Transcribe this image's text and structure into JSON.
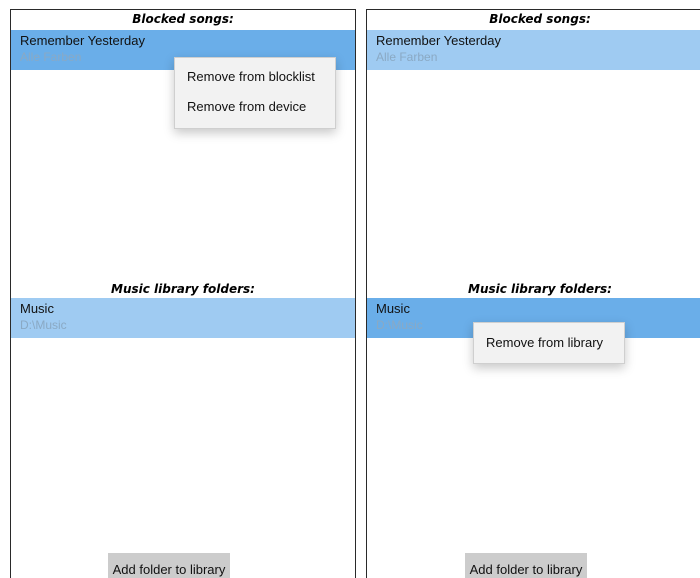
{
  "left_panel": {
    "blocked_header": "Blocked songs:",
    "blocked_songs": [
      {
        "title": "Remember Yesterday",
        "artist": "Alle Farben"
      }
    ],
    "context_menu": {
      "items": [
        "Remove from blocklist",
        "Remove from device"
      ]
    },
    "folders_header": "Music library folders:",
    "folders": [
      {
        "name": "Music",
        "path": "D:\\Music"
      }
    ],
    "add_folder_label": "Add folder to library"
  },
  "right_panel": {
    "blocked_header": "Blocked songs:",
    "blocked_songs": [
      {
        "title": "Remember Yesterday",
        "artist": "Alle Farben"
      }
    ],
    "folders_header": "Music library folders:",
    "folders": [
      {
        "name": "Music",
        "path": "D:\\Music"
      }
    ],
    "context_menu": {
      "items": [
        "Remove from library"
      ]
    },
    "add_folder_label": "Add folder to library"
  },
  "colors": {
    "item_selected": "#9fcbf2",
    "item_active": "#6aaee9",
    "button_bg": "#cccccc",
    "border": "#2a2a2a"
  }
}
